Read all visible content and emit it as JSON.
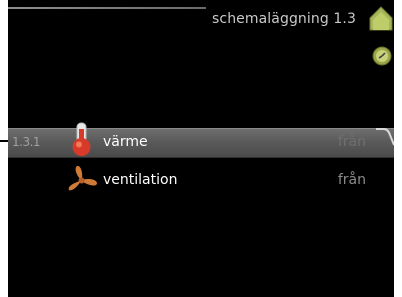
{
  "header": {
    "title": "schemaläggning 1.3"
  },
  "icons": {
    "home": "home-icon",
    "clock": "clock-icon",
    "heat": "thermometer-icon",
    "fan": "fan-icon"
  },
  "menu": {
    "items": [
      {
        "number": "1.3.1",
        "label": "värme",
        "value": "från",
        "selected": true
      },
      {
        "number": "",
        "label": "ventilation",
        "value": "från",
        "selected": false
      }
    ]
  },
  "colors": {
    "background": "#000000",
    "selected_row": "#5a5a5a",
    "home_icon": "#a8b65a",
    "clock_icon": "#9aa64a",
    "heat_icon": "#d83a2a",
    "fan_icon": "#d07a38"
  }
}
